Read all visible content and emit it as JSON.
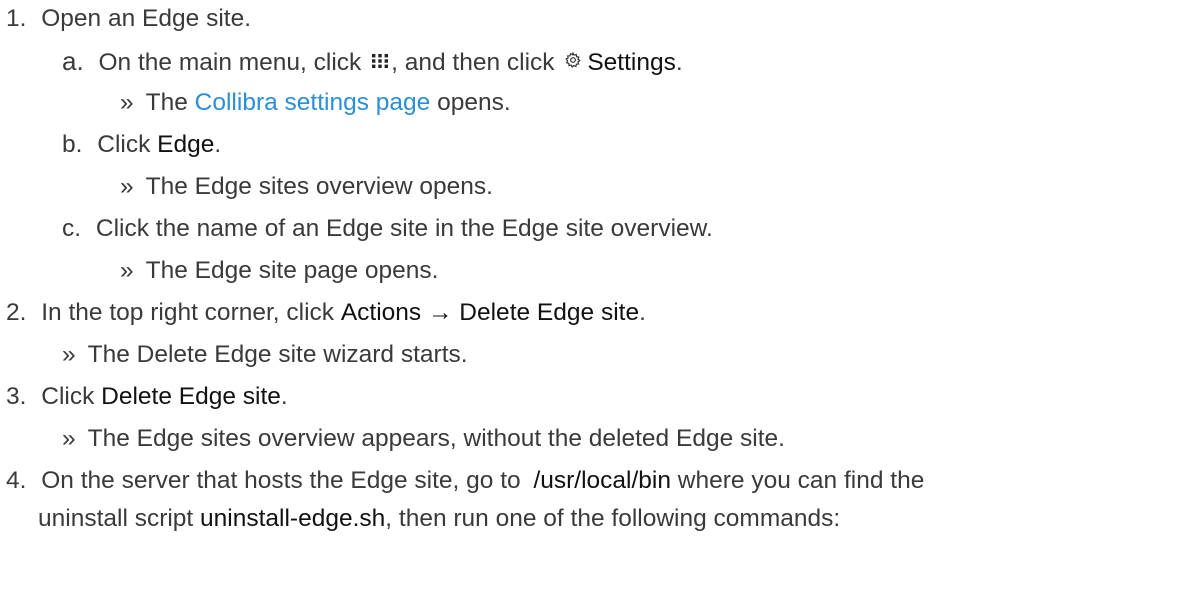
{
  "steps": [
    {
      "num": "1.",
      "text": "Open an Edge site."
    },
    {
      "num": "2.",
      "pre": "In the top right corner, click ",
      "bold": "Actions → Delete Edge site",
      "post": "."
    },
    {
      "num": "3.",
      "pre": "Click ",
      "bold": "Delete Edge site",
      "post": "."
    },
    {
      "num": "4.",
      "pre": "On the server that hosts the Edge site, go to ",
      "bold": "/usr/local/bin",
      "mid": " where you can find the"
    }
  ],
  "substeps": [
    {
      "letter": "a.",
      "pre": "On the main menu, click ",
      "icon1": "grid-menu-icon",
      "mid": ", and then click ",
      "icon2": "gear-icon",
      "bold": "Settings",
      "post": "."
    },
    {
      "letter": "b.",
      "pre": "Click ",
      "bold": "Edge",
      "post": "."
    },
    {
      "letter": "c.",
      "text": "Click the name of an Edge site in the Edge site overview."
    }
  ],
  "results": {
    "marker": "»",
    "a_pre": "The ",
    "a_link": "Collibra settings page",
    "a_post": " opens.",
    "b": "The Edge sites overview opens.",
    "c": "The Edge site page opens.",
    "step2": "The Delete Edge site wizard starts.",
    "step3": "The Edge sites overview appears, without the deleted Edge site."
  },
  "step4_cont": {
    "pre": "uninstall script ",
    "bold": "uninstall-edge.sh",
    "post": ", then run one of the following commands:"
  },
  "colors": {
    "text": "#3a3a3a",
    "bold": "#111111",
    "link": "#2a8fd6"
  }
}
